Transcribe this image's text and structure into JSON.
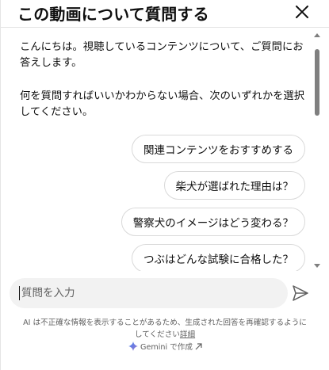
{
  "header": {
    "title": "この動画について質問する"
  },
  "messages": [
    "こんにちは。視聴しているコンテンツについて、ご質問にお答えします。",
    "何を質問すればいいかわからない場合、次のいずれかを選択してください。"
  ],
  "suggestions": [
    "関連コンテンツをおすすめする",
    "柴犬が選ばれた理由は？",
    "警察犬のイメージはどう変わる？",
    "つぶはどんな試験に合格した？"
  ],
  "input": {
    "placeholder": "質問を入力",
    "value": ""
  },
  "footer": {
    "disclaimer": "AI は不正確な情報を表示することがあるため、生成された回答を再確認するようにしてください",
    "learn_more": "詳細",
    "gemini_name": "Gemini",
    "gemini_suffix": " で作成"
  },
  "colors": {
    "text": "#0f0f0f",
    "secondary_text": "#606060",
    "chip_border": "#d9d9d9",
    "input_bg": "#f2f2f2",
    "scroll_thumb": "#7f7f7f"
  }
}
